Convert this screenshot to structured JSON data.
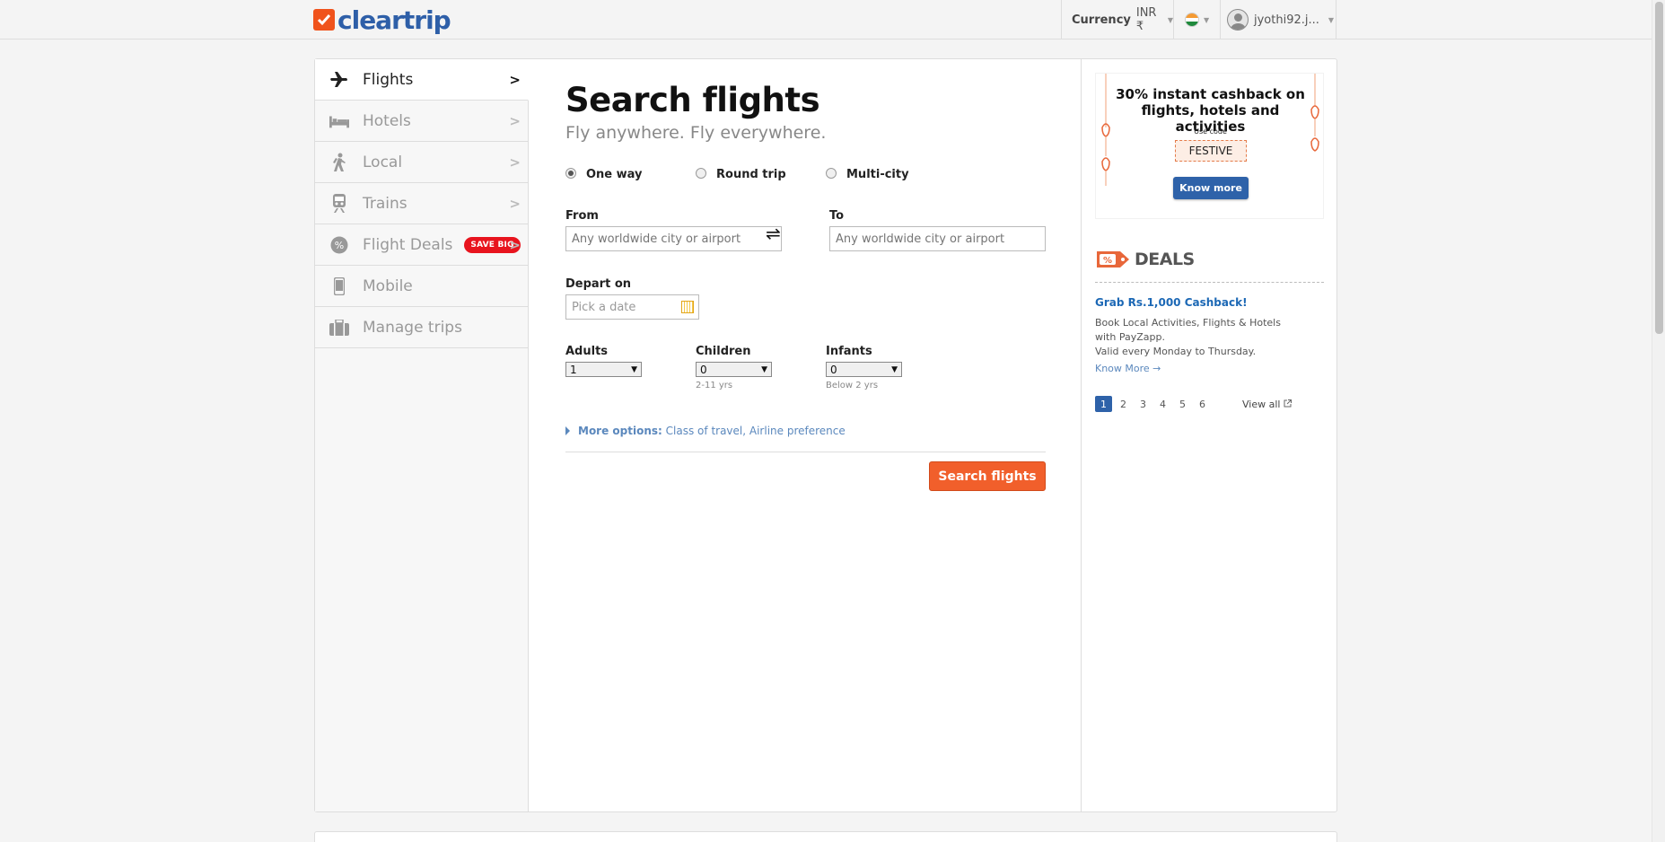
{
  "header": {
    "brand": "cleartrip",
    "currency_label": "Currency",
    "currency_value": "INR ₹",
    "user_name": "jyothi92.j..."
  },
  "nav": {
    "items": [
      {
        "label": "Flights"
      },
      {
        "label": "Hotels"
      },
      {
        "label": "Local"
      },
      {
        "label": "Trains"
      },
      {
        "label": "Flight Deals",
        "badge": "SAVE BIG"
      },
      {
        "label": "Mobile"
      },
      {
        "label": "Manage trips"
      }
    ]
  },
  "search": {
    "title": "Search flights",
    "tagline": "Fly anywhere. Fly everywhere.",
    "trip_types": [
      "One way",
      "Round trip",
      "Multi-city"
    ],
    "selected_trip": "One way",
    "from_label": "From",
    "to_label": "To",
    "from_placeholder": "Any worldwide city or airport",
    "to_placeholder": "Any worldwide city or airport",
    "swap_symbol": "⇌",
    "depart_label": "Depart on",
    "depart_placeholder": "Pick a date",
    "adults_label": "Adults",
    "adults_value": "1",
    "children_label": "Children",
    "children_value": "0",
    "children_hint": "2-11 yrs",
    "infants_label": "Infants",
    "infants_value": "0",
    "infants_hint": "Below 2 yrs",
    "more_options_label": "More options:",
    "more_options_detail": "Class of travel, Airline preference",
    "submit_label": "Search flights"
  },
  "promo": {
    "title": "30% instant cashback on flights, hotels and activities",
    "use_code_label": "Use code",
    "code": "FESTIVE",
    "button": "Know more"
  },
  "deals": {
    "heading": "DEALS",
    "badge_symbol": "%",
    "title": "Grab Rs.1,000 Cashback!",
    "desc_line1": "Book Local Activities, Flights & Hotels",
    "desc_line2": "with PayZapp.",
    "desc_line3": "Valid every Monday to Thursday.",
    "know_more": "Know More →",
    "pages": [
      "1",
      "2",
      "3",
      "4",
      "5",
      "6"
    ],
    "current_page": "1",
    "view_all": "View all"
  },
  "colors": {
    "brand_orange": "#f15f2b",
    "brand_blue": "#2e62a9",
    "link_blue": "#1c68b5",
    "badge_red": "#e8141e"
  }
}
